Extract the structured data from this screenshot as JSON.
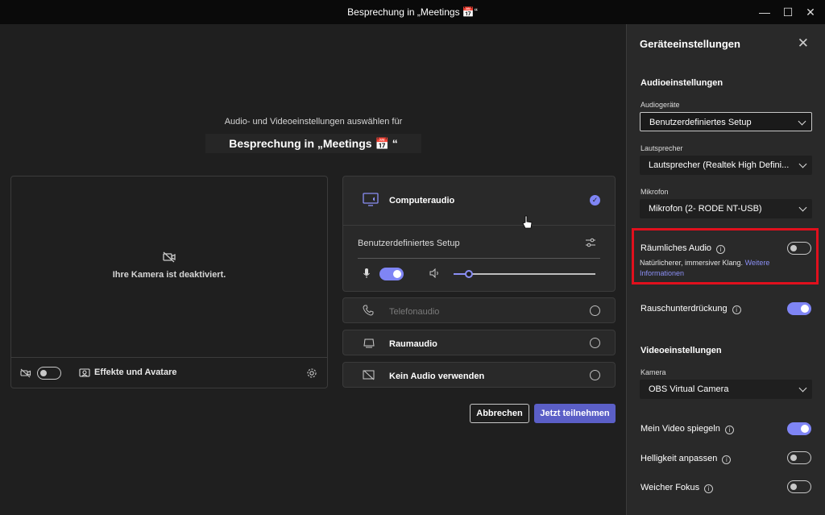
{
  "window": {
    "title": "Besprechung in „Meetings 📅“",
    "controls": [
      "minimize",
      "maximize",
      "close"
    ]
  },
  "prejoin": {
    "subtitle": "Audio- und Videoeinstellungen auswählen für",
    "meeting_title": "Besprechung in „Meetings 📅 “",
    "camera": {
      "status": "Ihre Kamera ist deaktiviert.",
      "camera_toggle": "off",
      "effects_label": "Effekte und Avatare"
    },
    "audio_options": {
      "computer": {
        "label": "Computeraudio",
        "selected": true
      },
      "custom_setup": "Benutzerdefiniertes Setup",
      "mic_toggle": "on",
      "volume_level": 0.12,
      "phone": {
        "label": "Telefonaudio",
        "selected": false
      },
      "room": {
        "label": "Raumaudio",
        "selected": false
      },
      "none": {
        "label": "Kein Audio verwenden",
        "selected": false
      }
    },
    "buttons": {
      "cancel": "Abbrechen",
      "join": "Jetzt teilnehmen"
    }
  },
  "device_settings": {
    "title": "Geräteeinstellungen",
    "audio_section": "Audioeinstellungen",
    "audio_devices_label": "Audiogeräte",
    "audio_devices_value": "Benutzerdefiniertes Setup",
    "speaker_label": "Lautsprecher",
    "speaker_value": "Lautsprecher (Realtek High Defini...",
    "mic_label": "Mikrofon",
    "mic_value": "Mikrofon (2- RODE NT-USB)",
    "spatial_label": "Räumliches Audio",
    "spatial_desc": "Natürlicherer, immersiver Klang.",
    "spatial_link": "Weitere Informationen",
    "spatial_toggle": "off",
    "noise_label": "Rauschunterdrückung",
    "noise_toggle": "on",
    "video_section": "Videoeinstellungen",
    "camera_label": "Kamera",
    "camera_value": "OBS Virtual Camera",
    "mirror_label": "Mein Video spiegeln",
    "mirror_toggle": "on",
    "brightness_label": "Helligkeit anpassen",
    "brightness_toggle": "off",
    "softfocus_label": "Weicher Fokus",
    "softfocus_toggle": "off"
  },
  "colors": {
    "accent": "#7f85f5",
    "highlight_box": "#e0101d",
    "background": "#1f1f1f",
    "panel": "#292929"
  }
}
